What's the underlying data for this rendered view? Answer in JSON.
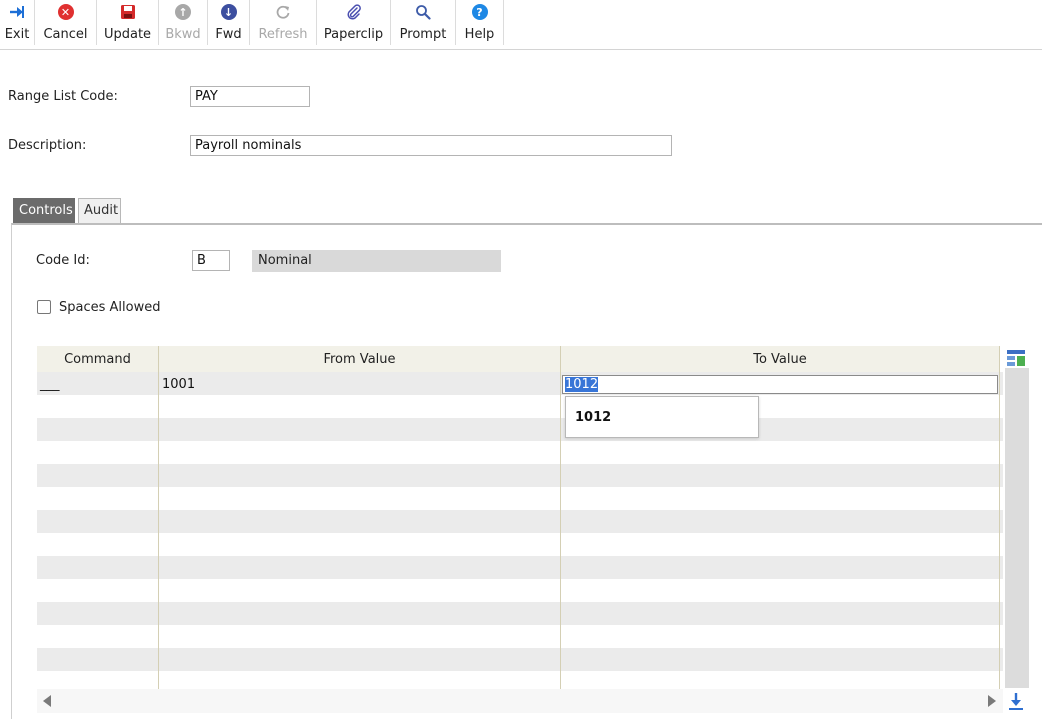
{
  "toolbar": {
    "exit": "Exit",
    "cancel": "Cancel",
    "update": "Update",
    "bkwd": "Bkwd",
    "fwd": "Fwd",
    "refresh": "Refresh",
    "paperclip": "Paperclip",
    "prompt": "Prompt",
    "help": "Help"
  },
  "form": {
    "range_list_code_label": "Range List Code:",
    "range_list_code_value": "PAY",
    "description_label": "Description:",
    "description_value": "Payroll nominals"
  },
  "tabs": [
    "Controls",
    "Audit"
  ],
  "controls": {
    "code_id_label": "Code Id:",
    "code_id_value": "B",
    "code_id_description": "Nominal",
    "spaces_allowed_label": "Spaces Allowed",
    "spaces_allowed_checked": false
  },
  "grid": {
    "columns": [
      "Command",
      "From Value",
      "To Value"
    ],
    "rows": [
      {
        "command": "___",
        "from": "1001",
        "to": "1012"
      }
    ],
    "editing_value": "1012",
    "dropdown_options": [
      "1012"
    ]
  },
  "colors": {
    "accent_selection": "#3875d7",
    "tab_active": "#6b6b6b",
    "grid_header": "#f2f1e8",
    "row_shaded": "#ebebeb"
  }
}
